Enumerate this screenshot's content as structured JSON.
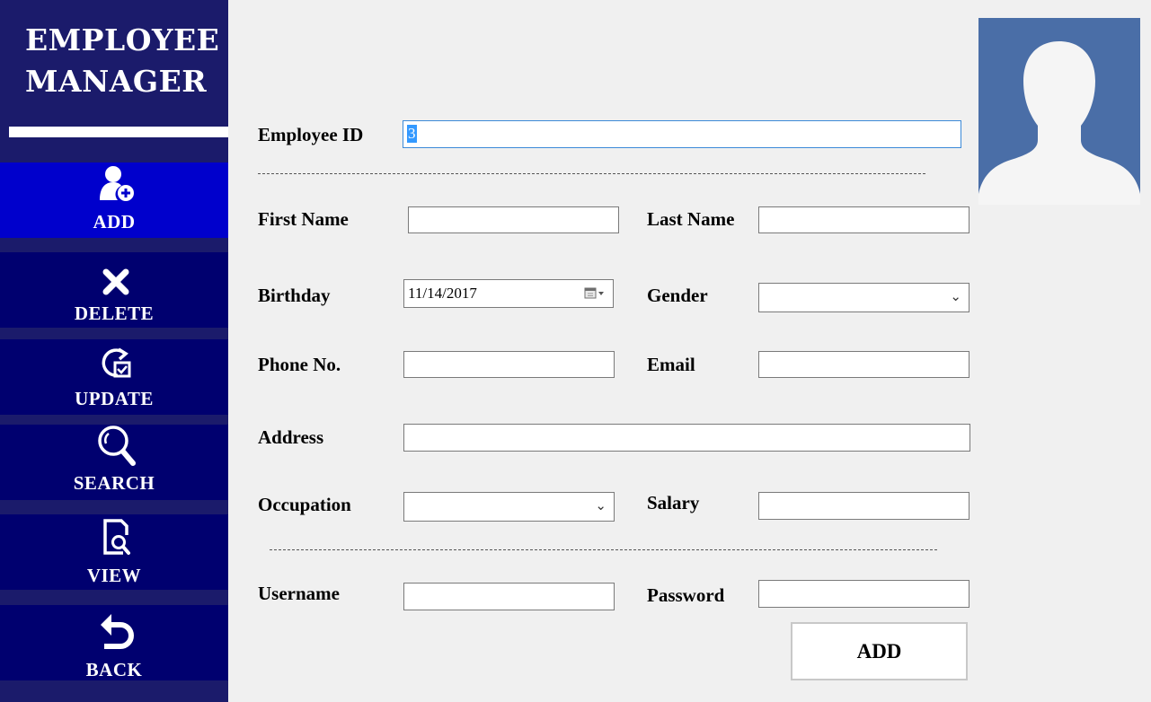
{
  "app": {
    "title": "EMPLOYEE MANAGER"
  },
  "sidebar": {
    "items": [
      {
        "label": "ADD",
        "icon": "add-user-icon",
        "active": true
      },
      {
        "label": "DELETE",
        "icon": "close-icon"
      },
      {
        "label": "UPDATE",
        "icon": "update-icon"
      },
      {
        "label": "SEARCH",
        "icon": "search-icon"
      },
      {
        "label": "VIEW",
        "icon": "view-document-icon"
      },
      {
        "label": "BACK",
        "icon": "back-arrow-icon"
      }
    ]
  },
  "form": {
    "employee_id": {
      "label": "Employee ID",
      "value": "3"
    },
    "first_name": {
      "label": "First Name",
      "value": ""
    },
    "last_name": {
      "label": "Last Name",
      "value": ""
    },
    "birthday": {
      "label": "Birthday",
      "value": "11/14/2017"
    },
    "gender": {
      "label": "Gender",
      "value": ""
    },
    "phone": {
      "label": "Phone No.",
      "value": ""
    },
    "email": {
      "label": "Email",
      "value": ""
    },
    "address": {
      "label": "Address",
      "value": ""
    },
    "occupation": {
      "label": "Occupation",
      "value": ""
    },
    "salary": {
      "label": "Salary",
      "value": ""
    },
    "username": {
      "label": "Username",
      "value": ""
    },
    "password": {
      "label": "Password",
      "value": ""
    },
    "submit_label": "ADD"
  },
  "colors": {
    "sidebar": "#1b1b6b",
    "nav_button": "#00006f",
    "nav_active": "#0000cc",
    "avatar_bg": "#4a6ea7",
    "background": "#f0f0f0"
  }
}
